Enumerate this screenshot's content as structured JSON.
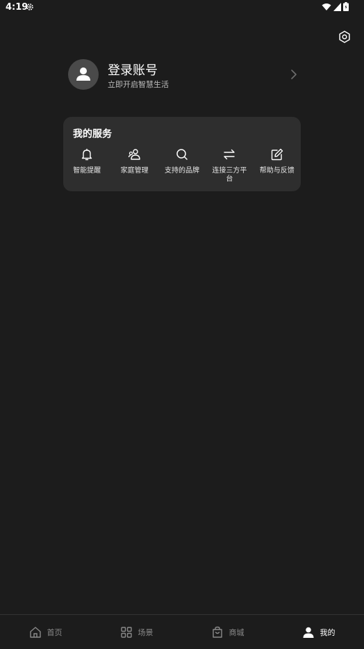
{
  "status_bar": {
    "time": "4:19"
  },
  "profile": {
    "title": "登录账号",
    "subtitle": "立即开启智慧生活"
  },
  "services": {
    "title": "我的服务",
    "items": [
      {
        "label": "智能提醒",
        "icon": "bell-icon"
      },
      {
        "label": "家庭管理",
        "icon": "family-icon"
      },
      {
        "label": "支持的品牌",
        "icon": "search-icon"
      },
      {
        "label": "连接三方平台",
        "icon": "swap-icon"
      },
      {
        "label": "帮助与反馈",
        "icon": "edit-icon"
      }
    ]
  },
  "bottom_nav": {
    "items": [
      {
        "label": "首页",
        "icon": "home-icon"
      },
      {
        "label": "场景",
        "icon": "grid-icon"
      },
      {
        "label": "商城",
        "icon": "shopping-bag-icon"
      },
      {
        "label": "我的",
        "icon": "person-icon"
      }
    ],
    "active": "我的"
  }
}
